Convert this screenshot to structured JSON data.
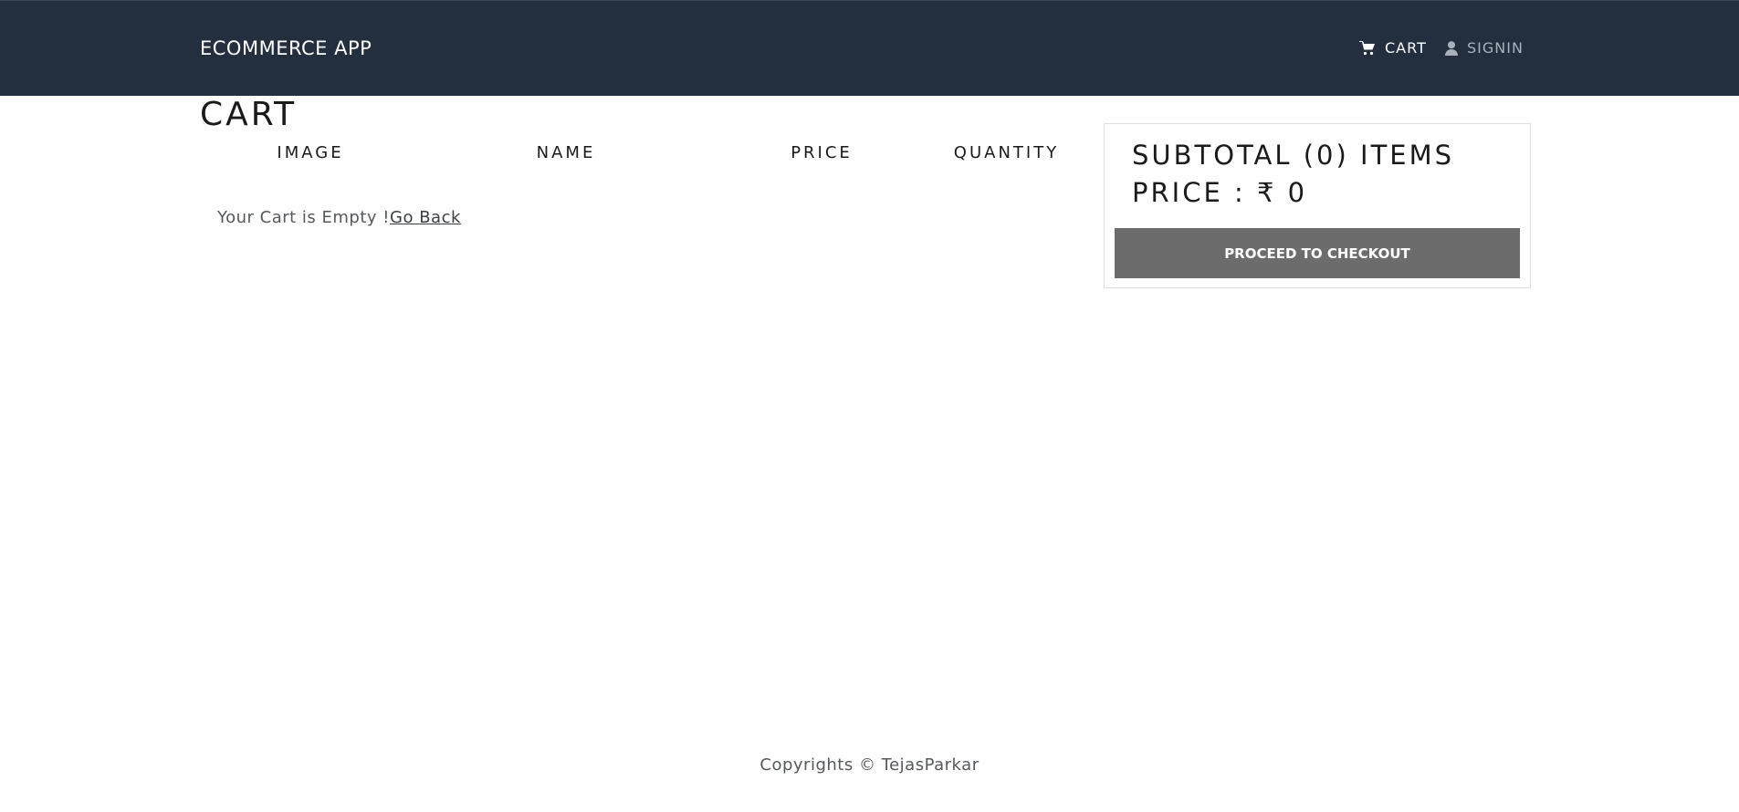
{
  "header": {
    "brand": "ECOMMERCE APP",
    "nav": {
      "cart_label": "CART",
      "signin_label": "SIGNIN"
    },
    "icons": {
      "cart": "shopping-cart-icon",
      "user": "user-icon"
    },
    "colors": {
      "background": "#232f3e",
      "active": "#ffffff",
      "inactive": "#a9b2bc"
    }
  },
  "main": {
    "title": "CART",
    "columns": [
      "IMAGE",
      "NAME",
      "PRICE",
      "QUANTITY"
    ],
    "empty_message": "Your Cart is Empty !",
    "go_back_label": "Go Back"
  },
  "summary": {
    "subtotal_label": "SUBTOTAL (0) ITEMS",
    "price_label": "PRICE : ₹ 0",
    "checkout_label": "PROCEED TO CHECKOUT",
    "button_color": "#6c6c6c"
  },
  "footer": {
    "copyright": "Copyrights © TejasParkar"
  }
}
